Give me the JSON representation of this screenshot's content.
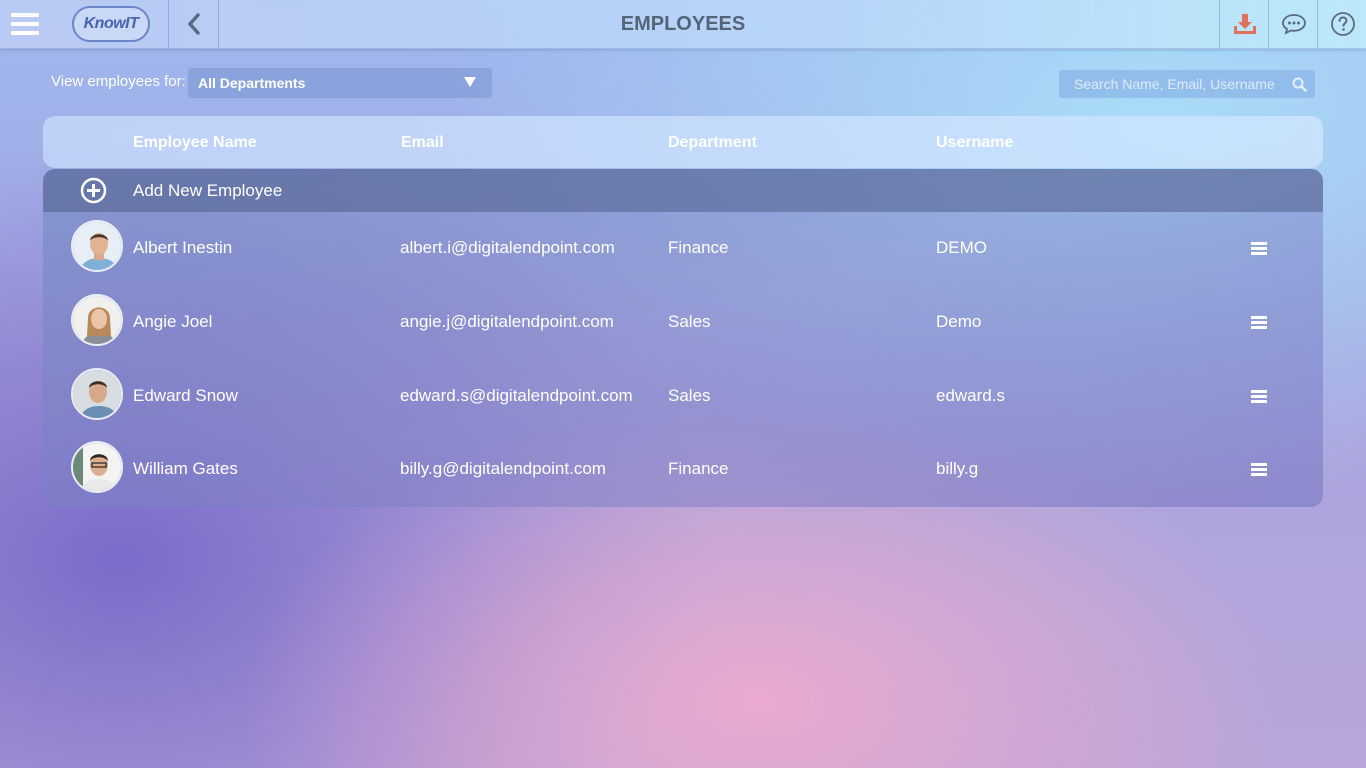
{
  "header": {
    "title": "EMPLOYEES",
    "logo_text": "KnowIT"
  },
  "filter": {
    "label": "View employees for:",
    "selected": "All Departments"
  },
  "search": {
    "placeholder": "Search Name, Email, Username",
    "value": ""
  },
  "table": {
    "columns": [
      "Employee Name",
      "Email",
      "Department",
      "Username"
    ],
    "add_label": "Add New Employee",
    "rows": [
      {
        "name": "Albert Inestin",
        "email": "albert.i@digitalendpoint.com",
        "department": "Finance",
        "username": "DEMO"
      },
      {
        "name": "Angie Joel",
        "email": "angie.j@digitalendpoint.com",
        "department": "Sales",
        "username": "Demo"
      },
      {
        "name": "Edward Snow",
        "email": "edward.s@digitalendpoint.com",
        "department": "Sales",
        "username": "edward.s"
      },
      {
        "name": "William Gates",
        "email": "billy.g@digitalendpoint.com",
        "department": "Finance",
        "username": "billy.g"
      }
    ]
  },
  "colors": {
    "title_text": "#556478",
    "download_icon": "#e0705a",
    "icon_gray": "#5a6a85"
  }
}
